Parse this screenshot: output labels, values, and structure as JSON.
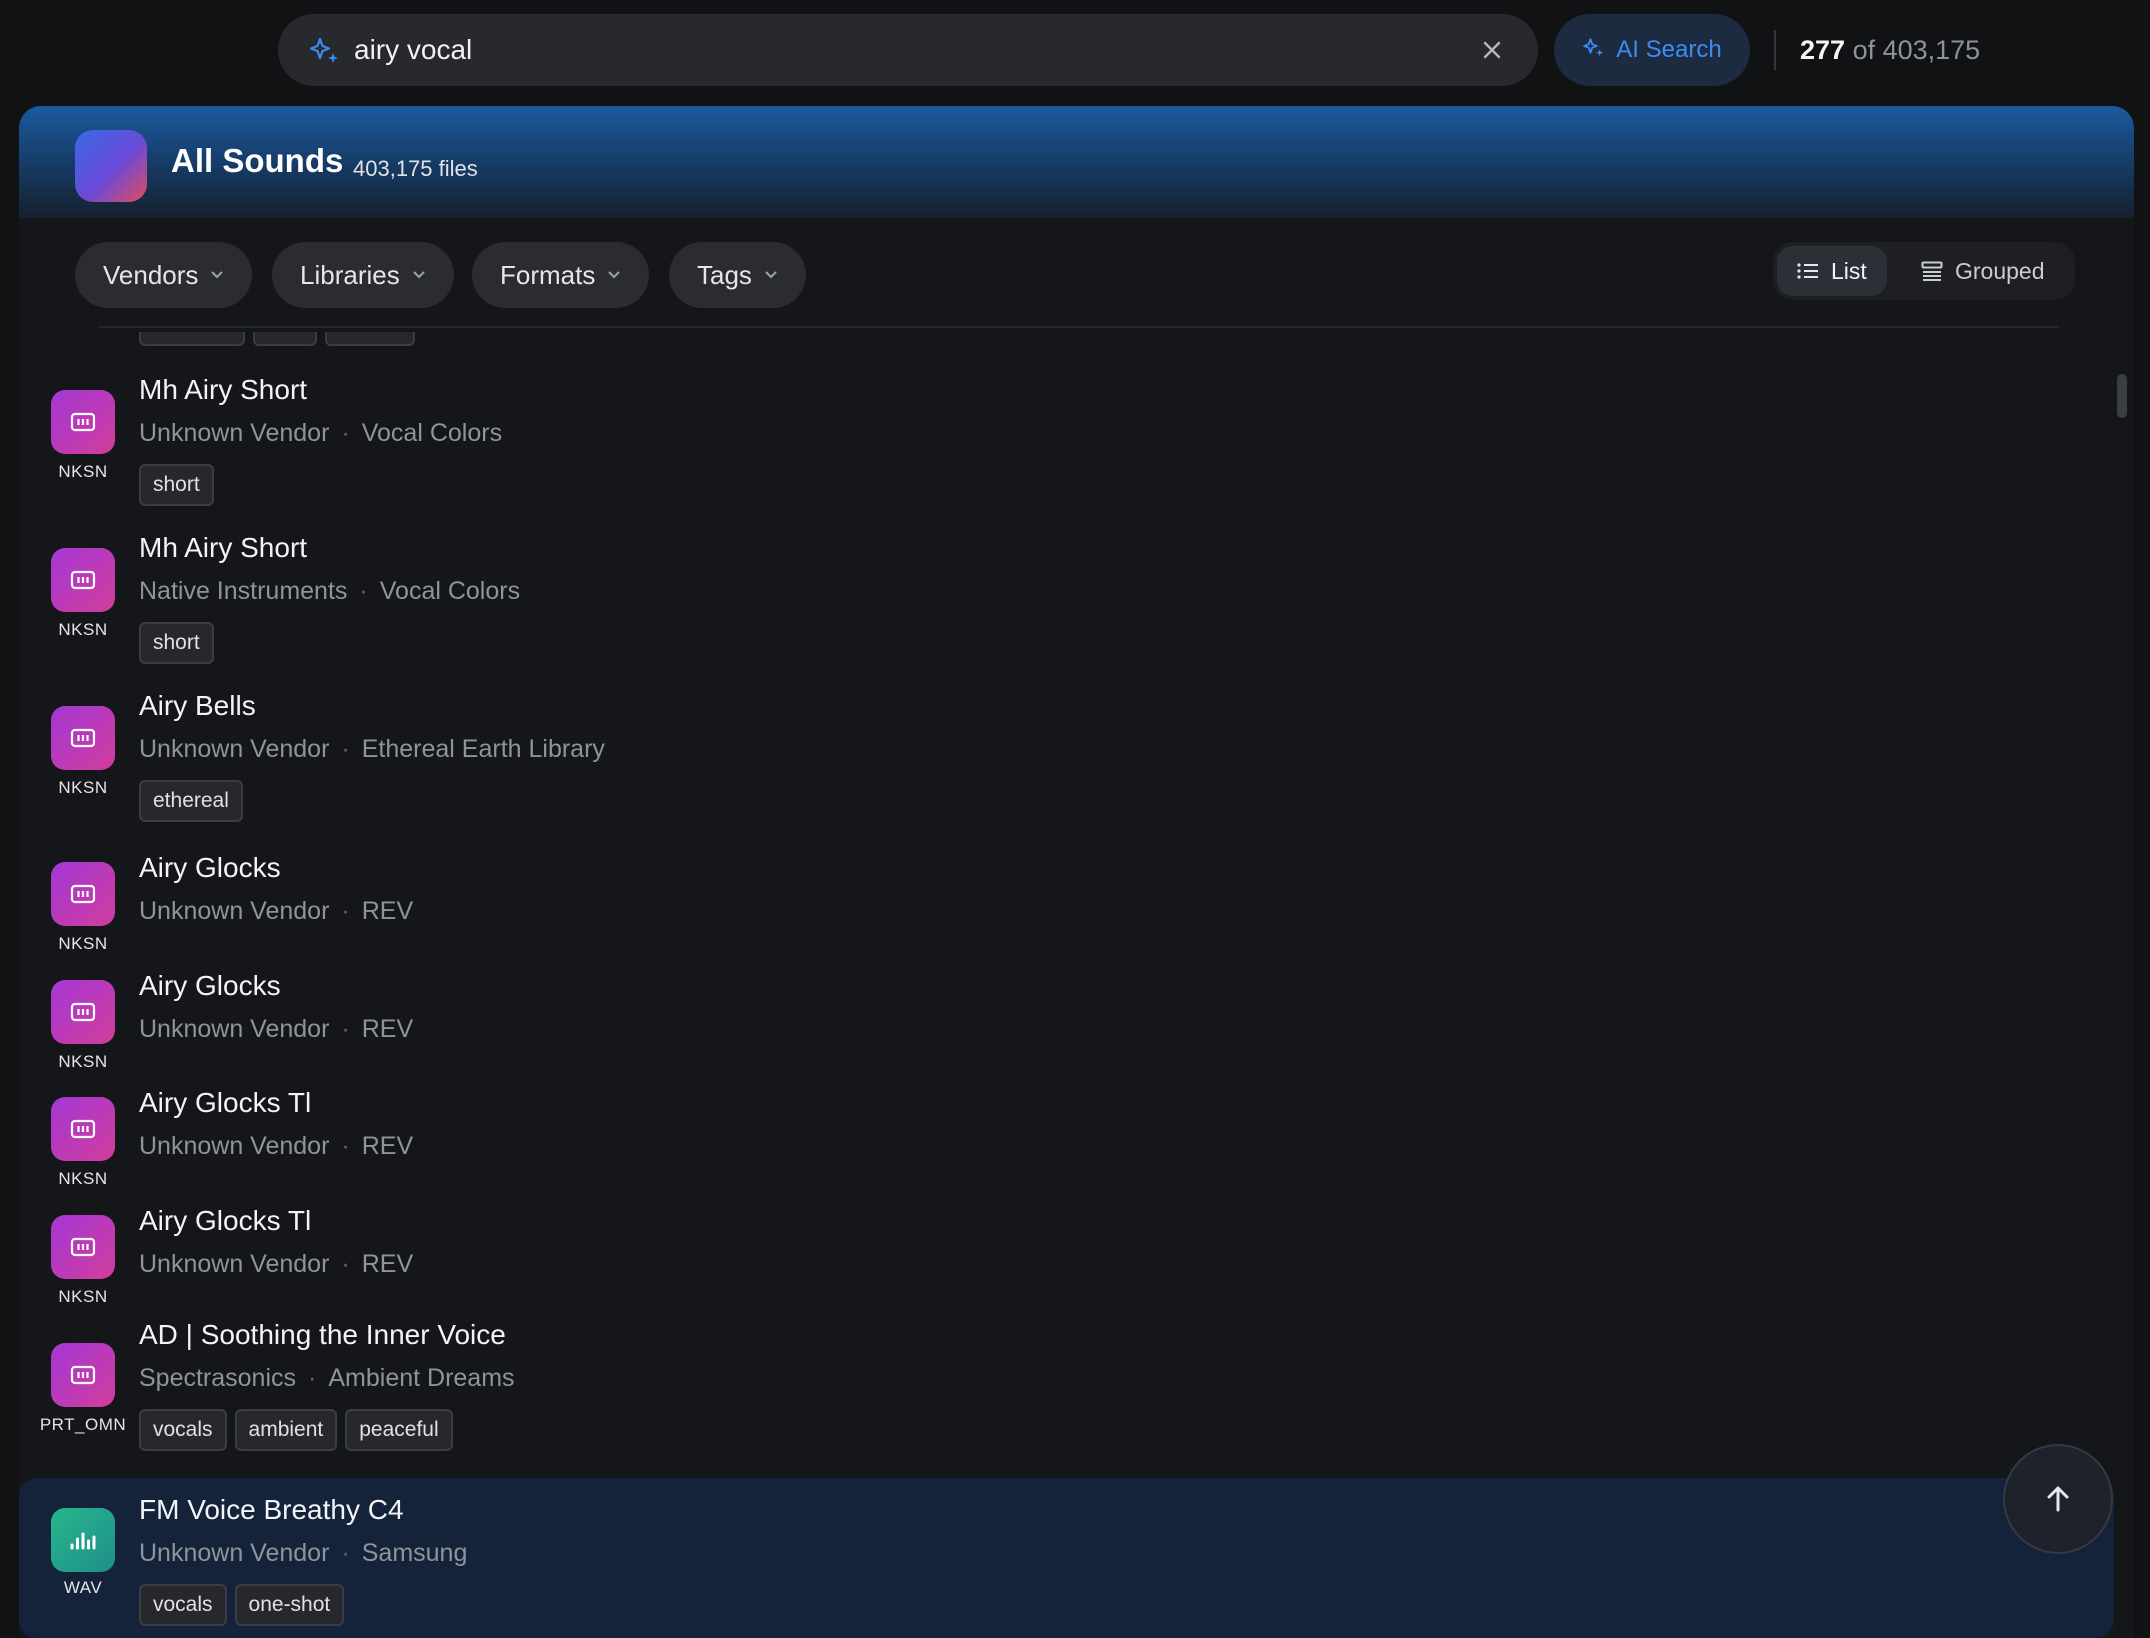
{
  "search": {
    "query": "airy vocal",
    "ai_label": "AI Search"
  },
  "results": {
    "shown": "277",
    "of_text": "of 403,175"
  },
  "panel": {
    "title": "All Sounds",
    "file_count": "403,175 files"
  },
  "filters": [
    {
      "label": "Vendors"
    },
    {
      "label": "Libraries"
    },
    {
      "label": "Formats"
    },
    {
      "label": "Tags"
    }
  ],
  "view_toggle": {
    "list": "List",
    "grouped": "Grouped",
    "active": "List"
  },
  "items": [
    {
      "format": "NKSN",
      "title": "Mh Airy Short",
      "vendor": "Unknown Vendor",
      "library": "Vocal Colors",
      "tags": [
        "short"
      ]
    },
    {
      "format": "NKSN",
      "title": "Mh Airy Short",
      "vendor": "Native Instruments",
      "library": "Vocal Colors",
      "tags": [
        "short"
      ]
    },
    {
      "format": "NKSN",
      "title": "Airy Bells",
      "vendor": "Unknown Vendor",
      "library": "Ethereal Earth Library",
      "tags": [
        "ethereal"
      ]
    },
    {
      "format": "NKSN",
      "title": "Airy Glocks",
      "vendor": "Unknown Vendor",
      "library": "REV",
      "tags": []
    },
    {
      "format": "NKSN",
      "title": "Airy Glocks",
      "vendor": "Unknown Vendor",
      "library": "REV",
      "tags": []
    },
    {
      "format": "NKSN",
      "title": "Airy Glocks Tl",
      "vendor": "Unknown Vendor",
      "library": "REV",
      "tags": []
    },
    {
      "format": "NKSN",
      "title": "Airy Glocks Tl",
      "vendor": "Unknown Vendor",
      "library": "REV",
      "tags": []
    },
    {
      "format": "PRT_OMN",
      "title": "AD  |  Soothing the Inner Voice",
      "vendor": "Spectrasonics",
      "library": "Ambient Dreams",
      "tags": [
        "vocals",
        "ambient",
        "peaceful"
      ]
    },
    {
      "format": "WAV",
      "title": "FM Voice Breathy C4",
      "vendor": "Unknown Vendor",
      "library": "Samsung",
      "tags": [
        "vocals",
        "one-shot"
      ]
    }
  ],
  "colors": {
    "accent": "#3b8cf2",
    "nksn_icon": "#b33ad0",
    "wav_icon": "#27b68c",
    "selected_row": "#14233a"
  },
  "icons": {
    "search": "sparkle-icon",
    "clear": "close-icon",
    "list": "list-icon",
    "grouped": "grouped-icon",
    "scroll_top": "arrow-up-icon",
    "instrument": "keyboard-icon",
    "audio": "waveform-icon"
  }
}
